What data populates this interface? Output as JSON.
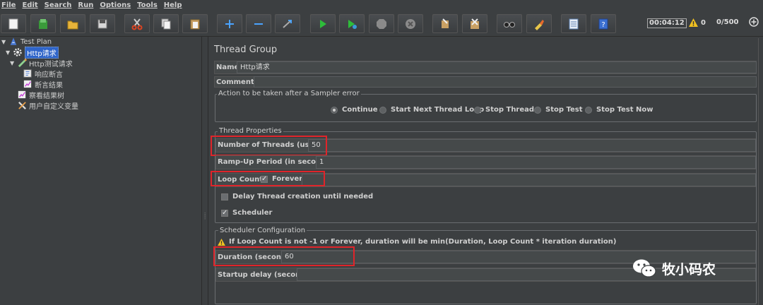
{
  "menu": [
    "File",
    "Edit",
    "Search",
    "Run",
    "Options",
    "Tools",
    "Help"
  ],
  "toolbar": {
    "buttons": [
      "new-icon",
      "templates-icon",
      "open-icon",
      "save-icon",
      "cut-icon",
      "copy-icon",
      "paste-icon",
      "expand-icon",
      "collapse-icon",
      "toggle-icon",
      "start-icon",
      "start-no-pauses-icon",
      "stop-icon",
      "shutdown-icon",
      "clear-icon",
      "clear-all-icon",
      "search-icon",
      "reset-search-icon",
      "function-helper-icon",
      "help-icon"
    ],
    "timer": "00:04:12",
    "warnings": "0",
    "threads": "0/500"
  },
  "tree": {
    "items": [
      {
        "label": "Test Plan",
        "icon": "test-plan-icon"
      },
      {
        "label": "Http请求",
        "icon": "thread-group-gear-icon"
      },
      {
        "label": "Http测试请求",
        "icon": "http-sampler-icon"
      },
      {
        "label": "响应断言",
        "icon": "assertion-icon"
      },
      {
        "label": "断言结果",
        "icon": "listener-chart-icon"
      },
      {
        "label": "察看结果树",
        "icon": "listener-chart-icon"
      },
      {
        "label": "用户自定义变量",
        "icon": "config-wrench-icon"
      }
    ]
  },
  "panel": {
    "title": "Thread Group",
    "name_label": "Name:",
    "name_value": "Http请求",
    "comments_label": "Comments:",
    "sampler_error": {
      "legend": "Action to be taken after a Sampler error",
      "options": [
        "Continue",
        "Start Next Thread Loop",
        "Stop Thread",
        "Stop Test",
        "Stop Test Now"
      ],
      "selected": "Continue"
    },
    "thread_props": {
      "legend": "Thread Properties",
      "num_threads_label": "Number of Threads (users):",
      "num_threads_value": "50",
      "rampup_label": "Ramp-Up Period (in seconds):",
      "rampup_value": "1",
      "loop_label": "Loop Count:",
      "forever_label": "Forever",
      "forever_checked": true,
      "delay_label": "Delay Thread creation until needed",
      "delay_checked": false,
      "scheduler_label": "Scheduler",
      "scheduler_checked": true
    },
    "scheduler": {
      "legend": "Scheduler Configuration",
      "info": "If Loop Count is not -1 or Forever, duration will be min(Duration, Loop Count * iteration duration)",
      "duration_label": "Duration (seconds)",
      "duration_value": "60",
      "startup_label": "Startup delay (seconds)",
      "startup_value": ""
    }
  },
  "watermark": "牧小码农",
  "colors": {
    "highlight": "#e0242a",
    "selection": "#2f65ca",
    "background": "#3c3f41"
  }
}
